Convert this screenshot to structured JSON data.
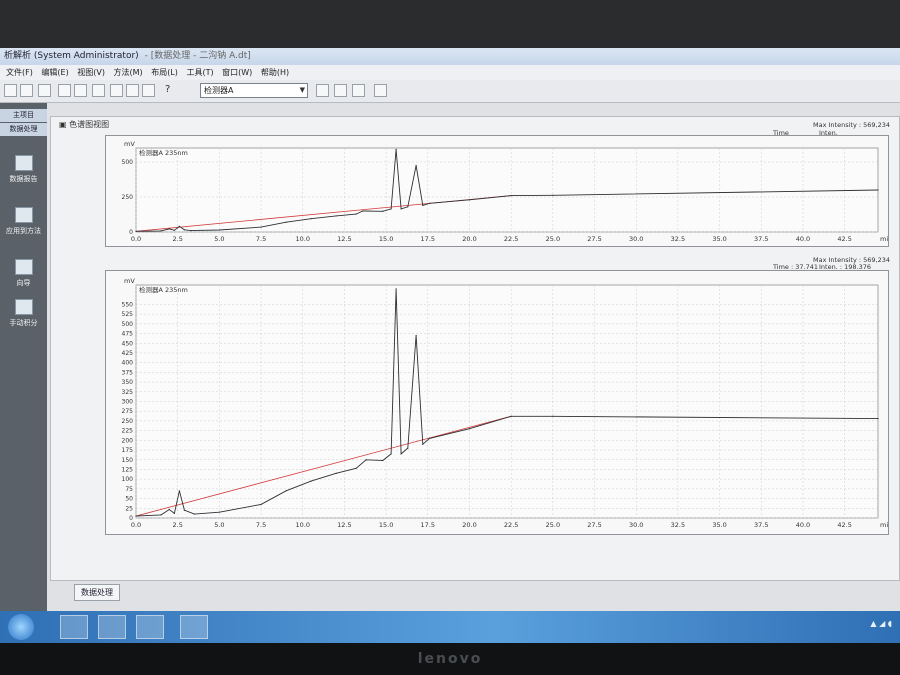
{
  "window": {
    "title": "析解析 (System Administrator)",
    "subtitle": "- [数据处理 - 二沟钠 A.dt]"
  },
  "menu": [
    "文件(F)",
    "编辑(E)",
    "视图(V)",
    "方法(M)",
    "布局(L)",
    "工具(T)",
    "窗口(W)",
    "帮助(H)"
  ],
  "toolbar": {
    "detector_select": "检测器A",
    "help_icon": "?"
  },
  "sidebar": {
    "tabs": [
      "主项目",
      "数据处理"
    ],
    "items": [
      "数据报告",
      "应用到方法",
      "向导",
      "手动积分"
    ]
  },
  "panel": {
    "title": "色谱图视图"
  },
  "chart_data": [
    {
      "type": "line",
      "title": "",
      "legend": "检测器A 235nm",
      "ylabel": "mV",
      "xlabel": "min",
      "xlim": [
        0,
        44.5
      ],
      "ylim": [
        0,
        600
      ],
      "yticks": [
        0,
        250,
        500
      ],
      "xticks": [
        "0.0",
        "2.5",
        "5.0",
        "7.5",
        "10.0",
        "12.5",
        "15.0",
        "17.5",
        "20.0",
        "22.5",
        "25.0",
        "27.5",
        "30.0",
        "32.5",
        "35.0",
        "37.5",
        "40.0",
        "42.5"
      ],
      "x": [
        0,
        1.5,
        2.0,
        2.3,
        2.6,
        2.9,
        3.3,
        5,
        7.5,
        9,
        10.5,
        12,
        13.2,
        13.6,
        14.8,
        15.3,
        15.6,
        15.9,
        16.3,
        16.8,
        17.2,
        17.6,
        20,
        22.5,
        25,
        44.5
      ],
      "y": [
        5,
        8,
        22,
        12,
        40,
        16,
        10,
        14,
        35,
        70,
        95,
        115,
        128,
        150,
        148,
        165,
        590,
        165,
        180,
        475,
        190,
        205,
        230,
        260,
        262,
        300
      ],
      "meta": {
        "max_intensity": "Max Intensity : 569,234",
        "time_label": "Time",
        "intensity_label": "Inten."
      }
    },
    {
      "type": "line",
      "title": "",
      "legend": "检测器A 235nm",
      "ylabel": "mV",
      "xlabel": "min",
      "xlim": [
        0,
        44.5
      ],
      "ylim": [
        0,
        600
      ],
      "yticks": [
        0,
        25,
        50,
        75,
        100,
        125,
        150,
        175,
        200,
        225,
        250,
        275,
        300,
        325,
        350,
        375,
        400,
        425,
        450,
        475,
        500,
        525,
        550
      ],
      "xticks": [
        "0.0",
        "2.5",
        "5.0",
        "7.5",
        "10.0",
        "12.5",
        "15.0",
        "17.5",
        "20.0",
        "22.5",
        "25.0",
        "27.5",
        "30.0",
        "32.5",
        "35.0",
        "37.5",
        "40.0",
        "42.5"
      ],
      "x": [
        0,
        1.5,
        2.0,
        2.3,
        2.6,
        2.9,
        3.5,
        5,
        7.5,
        9,
        10.5,
        12,
        13.2,
        13.8,
        14.8,
        15.3,
        15.6,
        15.9,
        16.3,
        16.8,
        17.2,
        17.6,
        20,
        22.5,
        25,
        44.5
      ],
      "y": [
        5,
        8,
        22,
        12,
        70,
        20,
        10,
        15,
        35,
        70,
        95,
        115,
        128,
        150,
        148,
        165,
        590,
        165,
        180,
        470,
        190,
        205,
        230,
        262,
        262,
        256
      ],
      "meta": {
        "max_intensity": "Max Intensity : 569,234",
        "time": "Time : 37.741",
        "intensity": "Inten. : 198.376"
      }
    }
  ],
  "bottom_tab": "数据处理",
  "brand": "lenovo"
}
